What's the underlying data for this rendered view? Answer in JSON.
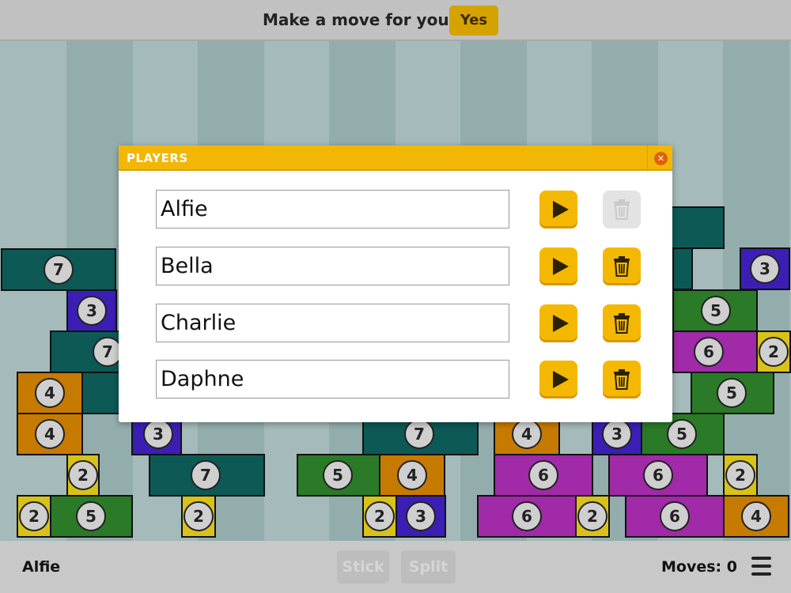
{
  "topbar": {
    "prompt": "Make a move for you?",
    "yes_label": "Yes"
  },
  "board": {
    "blocks": [
      {
        "color": "teal",
        "value": "7"
      },
      {
        "color": "blue",
        "value": "3"
      },
      {
        "color": "teal",
        "value": "7"
      },
      {
        "color": "orange",
        "value": "4"
      },
      {
        "color": "orange",
        "value": "4"
      },
      {
        "color": "yellow",
        "value": "2"
      },
      {
        "color": "yellow",
        "value": "2"
      },
      {
        "color": "green",
        "value": "5"
      },
      {
        "color": "blue",
        "value": "3"
      },
      {
        "color": "teal",
        "value": "7"
      },
      {
        "color": "yellow",
        "value": "2"
      },
      {
        "color": "teal",
        "value": "7"
      },
      {
        "color": "green",
        "value": "5"
      },
      {
        "color": "orange",
        "value": "4"
      },
      {
        "color": "yellow",
        "value": "2"
      },
      {
        "color": "blue",
        "value": "3"
      },
      {
        "color": "orange",
        "value": "4"
      },
      {
        "color": "purple",
        "value": "6"
      },
      {
        "color": "purple",
        "value": "6"
      },
      {
        "color": "yellow",
        "value": "2"
      },
      {
        "color": "blue",
        "value": "3"
      },
      {
        "color": "green",
        "value": "5"
      },
      {
        "color": "purple",
        "value": "6"
      },
      {
        "color": "yellow",
        "value": "2"
      },
      {
        "color": "purple",
        "value": "6"
      },
      {
        "color": "orange",
        "value": "4"
      },
      {
        "color": "blue",
        "value": "3"
      },
      {
        "color": "green",
        "value": "5"
      },
      {
        "color": "purple",
        "value": "6"
      },
      {
        "color": "yellow",
        "value": "2"
      },
      {
        "color": "green",
        "value": "5"
      }
    ]
  },
  "dialog": {
    "title": "PLAYERS",
    "players": [
      {
        "name": "Alfie",
        "delete_enabled": false
      },
      {
        "name": "Bella",
        "delete_enabled": true
      },
      {
        "name": "Charlie",
        "delete_enabled": true
      },
      {
        "name": "Daphne",
        "delete_enabled": true
      }
    ]
  },
  "bottombar": {
    "current_player": "Alfie",
    "stick_label": "Stick",
    "split_label": "Split",
    "moves_text": "Moves: 0"
  },
  "colors": {
    "accent": "#f2b705",
    "teal": "#0d5955",
    "blue": "#3b1fb5",
    "orange": "#c77a00",
    "yellow": "#d8c219",
    "green": "#2a7a28",
    "purple": "#a02aa8"
  }
}
